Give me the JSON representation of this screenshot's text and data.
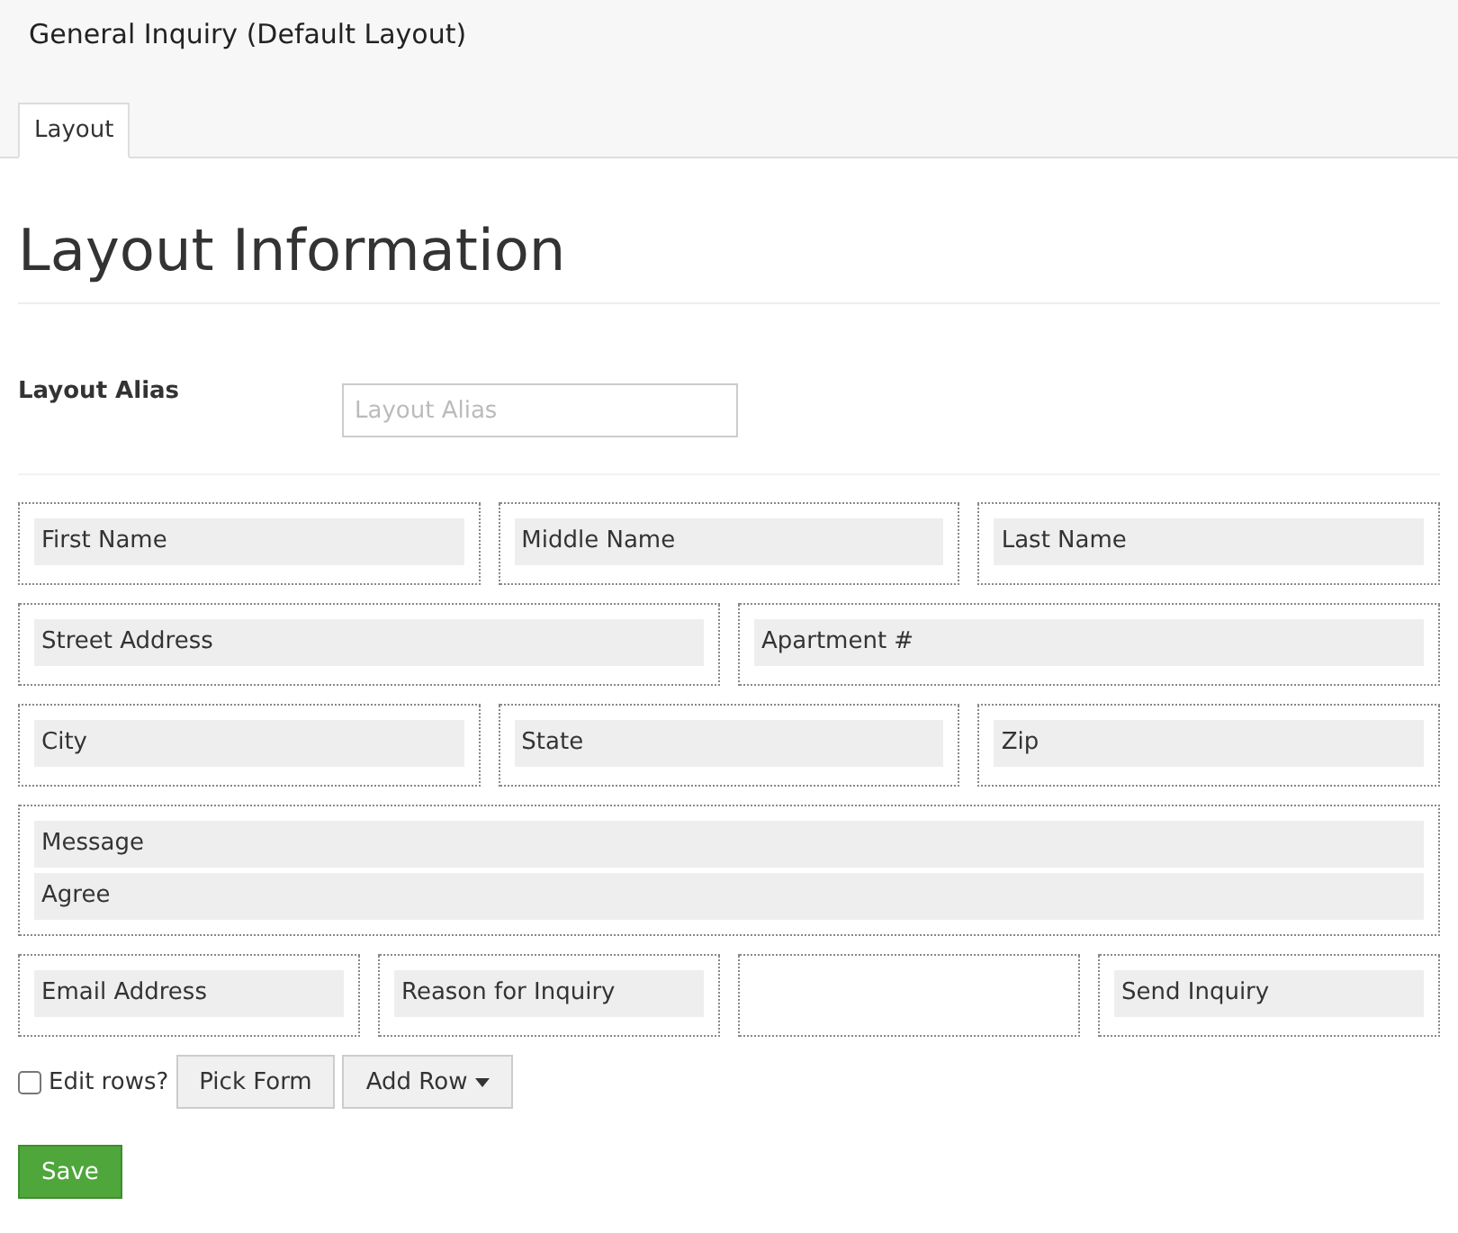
{
  "window": {
    "title": "General Inquiry (Default Layout)"
  },
  "tabs": [
    {
      "label": "Layout",
      "selected": true
    }
  ],
  "heading": "Layout Information",
  "alias": {
    "label": "Layout Alias",
    "placeholder": "Layout Alias"
  },
  "rows": [
    {
      "cells": [
        {
          "fields": [
            "First Name"
          ]
        },
        {
          "fields": [
            "Middle Name"
          ]
        },
        {
          "fields": [
            "Last Name"
          ]
        }
      ]
    },
    {
      "cells": [
        {
          "fields": [
            "Street Address"
          ]
        },
        {
          "fields": [
            "Apartment #"
          ]
        }
      ]
    },
    {
      "cells": [
        {
          "fields": [
            "City"
          ]
        },
        {
          "fields": [
            "State"
          ]
        },
        {
          "fields": [
            "Zip"
          ]
        }
      ]
    },
    {
      "cells": [
        {
          "fields": [
            "Message",
            "Agree"
          ]
        }
      ]
    },
    {
      "cells": [
        {
          "fields": [
            "Email Address"
          ]
        },
        {
          "fields": [
            "Reason for Inquiry"
          ]
        },
        {},
        {
          "fields": [
            "Send Inquiry"
          ]
        }
      ]
    }
  ],
  "edit_rows": {
    "label": "Edit rows?",
    "checked": false
  },
  "buttons": [
    {
      "label": "Pick Form",
      "kind": "plain"
    },
    {
      "label": "Add Row",
      "kind": "dropdown"
    }
  ],
  "save": "Save"
}
